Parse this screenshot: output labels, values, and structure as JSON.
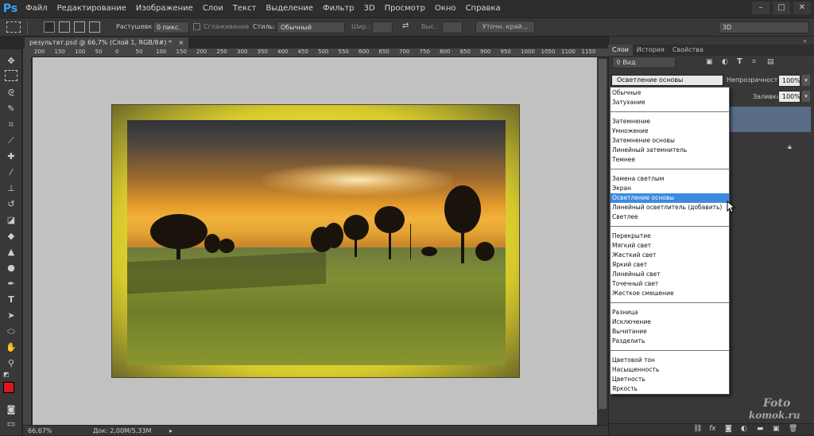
{
  "app": {
    "logo": "Ps",
    "menu": [
      "Файл",
      "Редактирование",
      "Изображение",
      "Слои",
      "Текст",
      "Выделение",
      "Фильтр",
      "3D",
      "Просмотр",
      "Окно",
      "Справка"
    ],
    "window_controls": [
      "–",
      "□",
      "✕"
    ]
  },
  "options_bar": {
    "feather_label": "Растушевка:",
    "feather_value": "0 пикс.",
    "antialias_label": "Сглаживание",
    "style_label": "Стиль:",
    "style_value": "Обычный",
    "width_label": "Шир.:",
    "height_label": "Выс.:",
    "refine_edge": "Уточн. край...",
    "workspace": "3D"
  },
  "document": {
    "tab_title": "результат.psd @ 66,7% (Слой 1, RGB/8#) *",
    "close_icon": "×",
    "ruler_ticks": [
      "200",
      "150",
      "100",
      "50",
      "0",
      "50",
      "100",
      "150",
      "200",
      "250",
      "300",
      "350",
      "400",
      "450",
      "500",
      "550",
      "600",
      "650",
      "700",
      "750",
      "800",
      "850",
      "900",
      "950",
      "1000",
      "1050",
      "1100",
      "1150"
    ]
  },
  "status_bar": {
    "zoom": "66,67%",
    "doc_size": "Док: 2,00M/5,33M"
  },
  "layers_panel": {
    "tabs": [
      "Слои",
      "История",
      "Свойства"
    ],
    "filter_label": "Вид",
    "blend_mode": "Осветление основы",
    "opacity_label": "Непрозрачность:",
    "opacity_value": "100%",
    "fill_label": "Заливка:",
    "fill_value": "100%",
    "bottom_icons": [
      "link-icon",
      "fx-icon",
      "mask-icon",
      "adjustment-icon",
      "folder-icon",
      "new-layer-icon",
      "trash-icon"
    ]
  },
  "blend_dropdown": {
    "groups": [
      [
        "Обычные",
        "Затухание"
      ],
      [
        "Затемнение",
        "Умножение",
        "Затемнение основы",
        "Линейный затемнитель",
        "Темнее"
      ],
      [
        "Замена светлым",
        "Экран",
        "Осветление основы",
        "Линейный осветлитель (добавить)",
        "Светлее"
      ],
      [
        "Перекрытие",
        "Мягкий свет",
        "Жесткий свет",
        "Яркий свет",
        "Линейный свет",
        "Точечный свет",
        "Жесткое смешение"
      ],
      [
        "Разница",
        "Исключение",
        "Вычитание",
        "Разделить"
      ],
      [
        "Цветовой тон",
        "Насыщенность",
        "Цветность",
        "Яркость"
      ]
    ],
    "selected": "Осветление основы"
  },
  "colors": {
    "foreground": "#e0141e",
    "background": "#ffffff",
    "selection": "#3d8be0",
    "layer_selected": "#5a6b86"
  },
  "watermark": {
    "line1": "Foto",
    "line2": "komok.ru"
  }
}
